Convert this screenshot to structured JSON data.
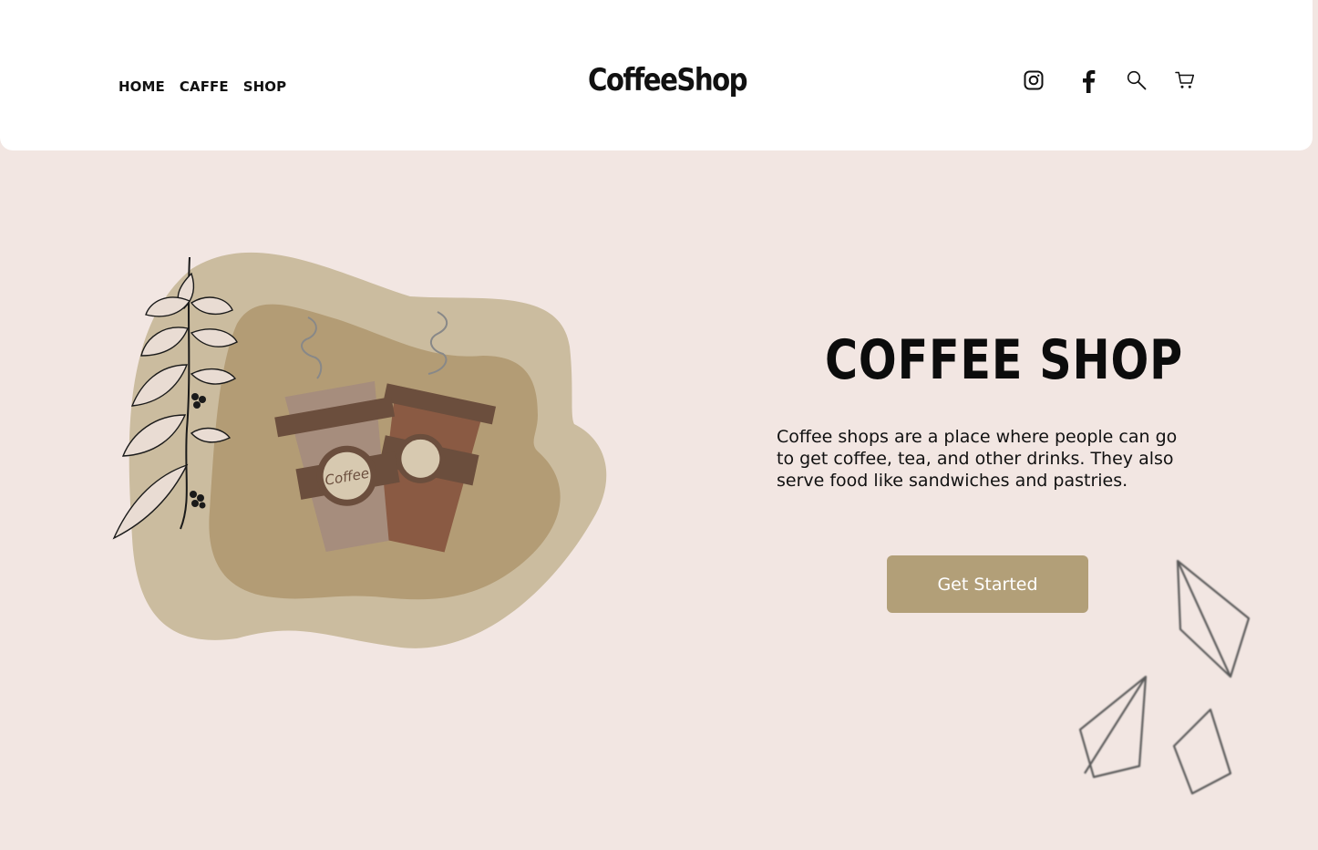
{
  "nav": {
    "items": [
      {
        "label": "HOME"
      },
      {
        "label": "CAFFE"
      },
      {
        "label": "SHOP"
      }
    ]
  },
  "brand": {
    "logo": "CoffeeShop"
  },
  "header_icons": [
    "instagram-icon",
    "facebook-icon",
    "search-icon",
    "cart-icon"
  ],
  "hero": {
    "title": "COFFEE SHOP",
    "description": "Coffee shops are a place where people can go to get coffee, tea, and other drinks. They also serve food like sandwiches and pastries.",
    "cta_label": "Get Started",
    "cup_label": "Coffee"
  },
  "colors": {
    "background": "#f2e6e2",
    "header": "#ffffff",
    "accent": "#b29f78",
    "blob_outer": "#cbbc9f",
    "blob_inner": "#b39c75",
    "cup_light": "#a68d7d",
    "cup_dark": "#8a5a43",
    "sleeve": "#6b4e3d"
  }
}
